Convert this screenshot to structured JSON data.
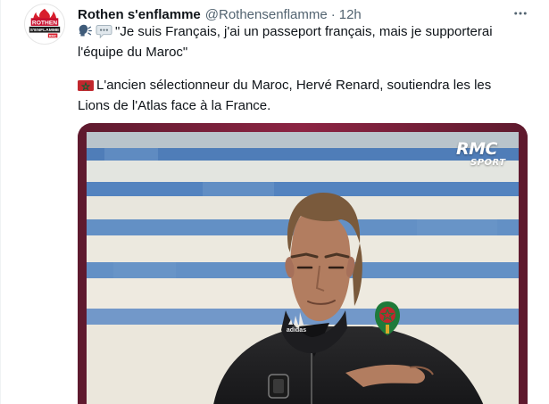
{
  "tweet": {
    "author_name": "Rothen s'enflamme",
    "author_handle": "@Rothensenflamme",
    "separator": "·",
    "time": "12h",
    "avatar_logo_text": [
      "ROTHEN",
      "S'ENFLAMME",
      "RMC"
    ],
    "quote_text": "\"Je suis Français, j'ai un passeport français, mais je supporterai l'équipe du Maroc\"",
    "body_text": "L'ancien sélectionneur du Maroc, Hervé Renard, soutiendra les les Lions de l'Atlas face à la France.",
    "icons": {
      "speaker": "speaking-head-icon",
      "speech_balloon": "speech-balloon-icon",
      "flag": "morocco-flag-icon",
      "more": "more-options-icon"
    },
    "media": {
      "brand_top": "RMC",
      "brand_bottom": "SPORT",
      "jacket_brand": "adidas"
    }
  }
}
